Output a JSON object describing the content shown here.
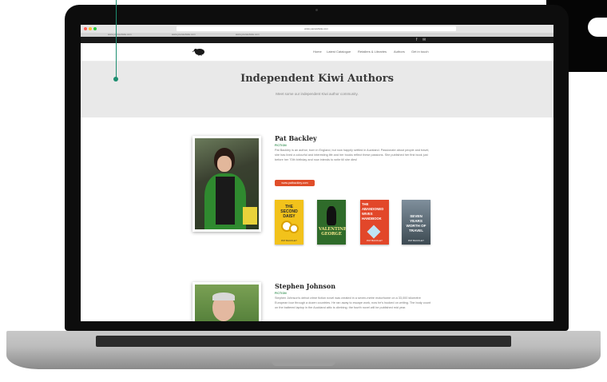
{
  "browser": {
    "url": "www.yourwebsite.com",
    "tabs": [
      "www.yourwebsite.com",
      "www.yourwebsite.com",
      "www.yourwebsite.com"
    ]
  },
  "site": {
    "nav": [
      "Home",
      "Latest Catalogue",
      "Retailers & Libraries",
      "Authors",
      "Get in touch"
    ],
    "social": [
      "f",
      "✉"
    ],
    "logo_icon": "kiwi-bird-logo"
  },
  "hero": {
    "title": "Independent Kiwi Authors",
    "subtitle": "Meet some our independent Kiwi author community."
  },
  "authors": [
    {
      "name": "Pat Backley",
      "genre": "FICTION",
      "bio": "Pat Backley is an author, born in England, but now happily settled in Auckland. Passionate about people and travel, she has lived a colourful and interesting life and her books reflect these passions. She published her first book just before her 70th birthday and now intends to write till she dies!",
      "button": "www.patbackley.com",
      "books": [
        {
          "title": "THE SECOND DAISY",
          "author": "PAT BACKLEY",
          "bg": "#f2c21b",
          "fg": "#2a2a2a"
        },
        {
          "title": "VALENTINE GEORGE",
          "author": "",
          "bg": "#2f6b2a",
          "fg": "#f1e48a"
        },
        {
          "title": "THE ABANDONED WIVES HANDBOOK",
          "author": "PAT BACKLEY",
          "bg": "#e2472a",
          "fg": "#ffffff"
        },
        {
          "title": "SEVEN YEARS WORTH OF TRAVEL",
          "author": "PAT BACKLEY",
          "bg": "#4a5a6a",
          "fg": "#ffffff"
        }
      ]
    },
    {
      "name": "Stephen Johnson",
      "genre": "FICTION",
      "bio": "Stephen Johnson's debut crime fiction novel was created in a seven-metre motorhome on a 33,000 kilometre European tour through a dozen countries. He ran away to escape work, now he's hooked on writing. The body count on the battered laptop in the Auckland attic is climbing; the fourth novel will be published mid year."
    }
  ],
  "colors": {
    "accent": "#e04e2a",
    "genre": "#2c8a4a",
    "pointer": "#1d8e70",
    "hero_bg": "#e9e9e9"
  }
}
